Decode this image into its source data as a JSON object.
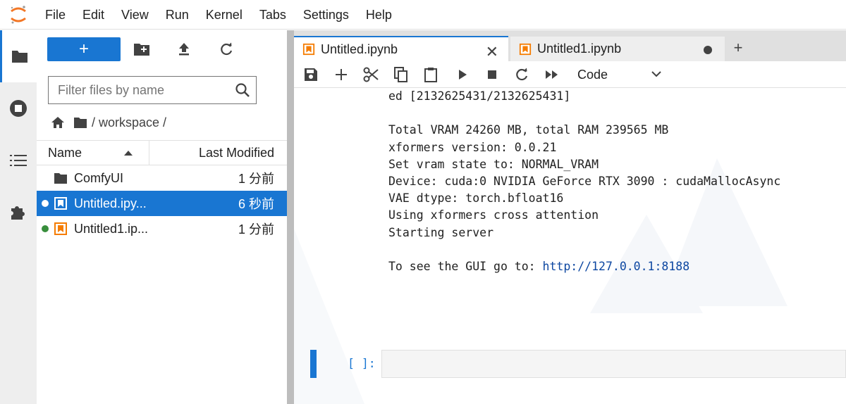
{
  "menubar": {
    "items": [
      "File",
      "Edit",
      "View",
      "Run",
      "Kernel",
      "Tabs",
      "Settings",
      "Help"
    ]
  },
  "activity": {
    "items": [
      "folder-icon",
      "running-icon",
      "toc-icon",
      "extension-icon"
    ]
  },
  "filebrowser": {
    "new_label": "+",
    "filter_placeholder": "Filter files by name",
    "breadcrumb_path": "/ workspace /",
    "columns": {
      "name": "Name",
      "modified": "Last Modified"
    },
    "rows": [
      {
        "name": "ComfyUI",
        "modified": "1 分前",
        "type": "folder",
        "running": false,
        "selected": false
      },
      {
        "name": "Untitled.ipy...",
        "modified": "6 秒前",
        "type": "notebook",
        "running": true,
        "selected": true
      },
      {
        "name": "Untitled1.ip...",
        "modified": "1 分前",
        "type": "notebook",
        "running": true,
        "selected": false
      }
    ]
  },
  "tabs": [
    {
      "label": "Untitled.ipynb",
      "active": true
    },
    {
      "label": "Untitled1.ipynb",
      "active": false
    }
  ],
  "notebook_toolbar": {
    "cell_type": "Code"
  },
  "output": {
    "lines": [
      "ed [2132625431/2132625431]",
      "",
      "Total VRAM 24260 MB, total RAM 239565 MB",
      "xformers version: 0.0.21",
      "Set vram state to: NORMAL_VRAM",
      "Device: cuda:0 NVIDIA GeForce RTX 3090 : cudaMallocAsync",
      "VAE dtype: torch.bfloat16",
      "Using xformers cross attention",
      "Starting server",
      ""
    ],
    "gui_prefix": "To see the GUI go to: ",
    "gui_link": "http://127.0.0.1:8188"
  },
  "input_cell": {
    "prompt": "[ ]:"
  },
  "colors": {
    "accent": "#1976d2",
    "notebook_orange": "#f57c00",
    "kernel_running": "#388e3c"
  }
}
